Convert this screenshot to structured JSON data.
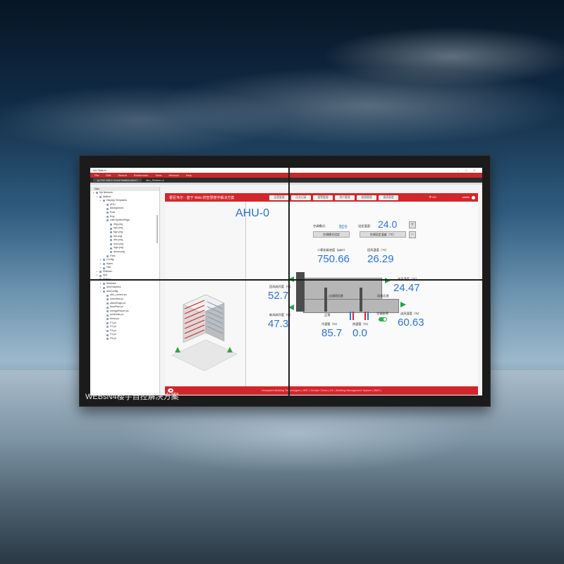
{
  "monitor": {
    "caption": "WEBsN4楼宇自控解决方案"
  },
  "browser": {
    "app_title": "N4 Station",
    "window_controls": "– □ ×",
    "menu": [
      "File",
      "Edit",
      "Search",
      "Bookmarks",
      "Tools",
      "Window",
      "Help"
    ],
    "address": "ip:192.168.1.1/ord?station:|slot:/",
    "address_extra": "ahu_Station.ui"
  },
  "sidebar": {
    "header": "Nav",
    "items": [
      {
        "label": "My Network",
        "indent": 0
      },
      {
        "label": "Station",
        "indent": 1
      },
      {
        "label": "Display Templates",
        "indent": 2
      },
      {
        "label": "AHU",
        "indent": 3
      },
      {
        "label": "Background",
        "indent": 3
      },
      {
        "label": "Eval",
        "indent": 3
      },
      {
        "label": "Eng",
        "indent": 3
      },
      {
        "label": "UserSystemPage",
        "indent": 3
      },
      {
        "label": "img.png",
        "indent": 4
      },
      {
        "label": "bg1.png",
        "indent": 4
      },
      {
        "label": "bg2.png",
        "indent": 4
      },
      {
        "label": "fan.png",
        "indent": 4
      },
      {
        "label": "ahu.png",
        "indent": 4
      },
      {
        "label": "icon.png",
        "indent": 4
      },
      {
        "label": "logo.png",
        "indent": 4
      },
      {
        "label": "arrow.png",
        "indent": 4
      },
      {
        "label": "Files",
        "indent": 3
      },
      {
        "label": "Config",
        "indent": 2
      },
      {
        "label": "Alarm",
        "indent": 2
      },
      {
        "label": "Hist",
        "indent": 2
      },
      {
        "label": "Platform",
        "indent": 1
      },
      {
        "label": "Spy",
        "indent": 1
      },
      {
        "label": "Station",
        "indent": 1
      },
      {
        "label": "Modules",
        "indent": 2
      },
      {
        "label": "ahuGraphics",
        "indent": 2
      },
      {
        "label": "ahuConfig",
        "indent": 2
      },
      {
        "label": "ahu_control.px",
        "indent": 3
      },
      {
        "label": "overview.px",
        "indent": 3
      },
      {
        "label": "alarmPage.px",
        "indent": 3
      },
      {
        "label": "floorPlan.px",
        "indent": 3
      },
      {
        "label": "energyReport.px",
        "indent": 3
      },
      {
        "label": "schedule.px",
        "indent": 3
      },
      {
        "label": "trend.px",
        "indent": 3
      },
      {
        "label": "F1.px",
        "indent": 3
      },
      {
        "label": "F2.px",
        "indent": 3
      },
      {
        "label": "F3.px",
        "indent": 3
      },
      {
        "label": "F4.px",
        "indent": 3
      },
      {
        "label": "F5.px",
        "indent": 3
      }
    ]
  },
  "hmi": {
    "title": "霍尼韦尔 - 基于 Web 的智慧楼宇解决方案",
    "tabs": [
      "运营管理",
      "历史记录",
      "报警管理",
      "用户管理",
      "权限管理",
      "报表管理"
    ],
    "lang": "中 EN",
    "user": "admin",
    "footer": "Honeywell Building Technologies ( HBT )   Greater China ( GC )   Building Management System ( BMS )",
    "ahu_title": "AHU-0",
    "mode_label": "空调模式：",
    "mode_value": "制冷",
    "setpoint_label": "设定温度：",
    "setpoint_value": "24.0",
    "mode_button": "空调模式设定",
    "setpoint_button": "空调设定温度（℃）",
    "co2_label": "二氧化碳浓度（ppm）",
    "co2_value": "750.66",
    "return_temp_label": "回风温度（℃）",
    "return_temp_value": "26.29",
    "return_damper_label": "回风阀开度（%）",
    "return_damper_value": "52.7",
    "supply_temp_label": "送风温度（℃）",
    "supply_temp_value": "24.47",
    "fresh_damper_label": "新风阀开度（%）",
    "fresh_damper_value": "47.3",
    "filter_label": "过滤网压差",
    "fan_label": "风机压差",
    "normal_label": "正常",
    "cold_valve_label": "冷盘管（%）",
    "cold_valve_value": "85.7",
    "hot_valve_label": "热盘管（%）",
    "hot_valve_value": "0.0",
    "ac_status_label": "空调启停",
    "supply_humidity_label": "送风湿度（%）",
    "supply_humidity_value": "60.63"
  },
  "colors": {
    "brand_red": "#d3262a",
    "value_blue": "#2a73d6",
    "status_green": "#21a24b"
  }
}
